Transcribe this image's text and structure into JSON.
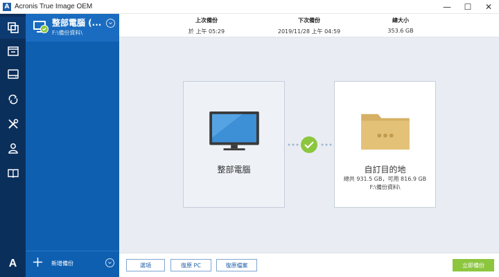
{
  "window": {
    "title": "Acronis True Image OEM",
    "app_icon_letter": "A",
    "minimize": "—",
    "maximize": "☐",
    "close": "✕"
  },
  "sidebar": {
    "logo_letter": "A",
    "items": [
      {
        "name": "backup",
        "icon": "copy-icon"
      },
      {
        "name": "archive",
        "icon": "archive-icon"
      },
      {
        "name": "disk",
        "icon": "disk-icon"
      },
      {
        "name": "sync",
        "icon": "sync-icon"
      },
      {
        "name": "tools",
        "icon": "tools-icon"
      },
      {
        "name": "account",
        "icon": "user-icon"
      },
      {
        "name": "help",
        "icon": "book-icon"
      }
    ]
  },
  "backup_list": {
    "item": {
      "title": "整部電腦 (...",
      "subtitle": "F:\\備份資料\\"
    },
    "add_label": "新增備份"
  },
  "info": {
    "last_label": "上次備份",
    "last_value": "於 上午 05:29",
    "next_label": "下次備份",
    "next_value": "2019/11/28 上午 04:59",
    "size_label": "總大小",
    "size_value": "353.6 GB"
  },
  "source": {
    "label": "整部電腦"
  },
  "destination": {
    "label": "自訂目的地",
    "stats": "總共 931.5 GB，可用 816.9 GB",
    "path": "F:\\備份資料\\"
  },
  "buttons": {
    "options": "選項",
    "recover_pc": "復原 PC",
    "recover_files": "復原檔案",
    "backup_now": "立即備份"
  },
  "colors": {
    "rail": "#0b2f5b",
    "panel": "#0f5fb0",
    "accent_green": "#8cc63f",
    "folder": "#e3c278"
  }
}
